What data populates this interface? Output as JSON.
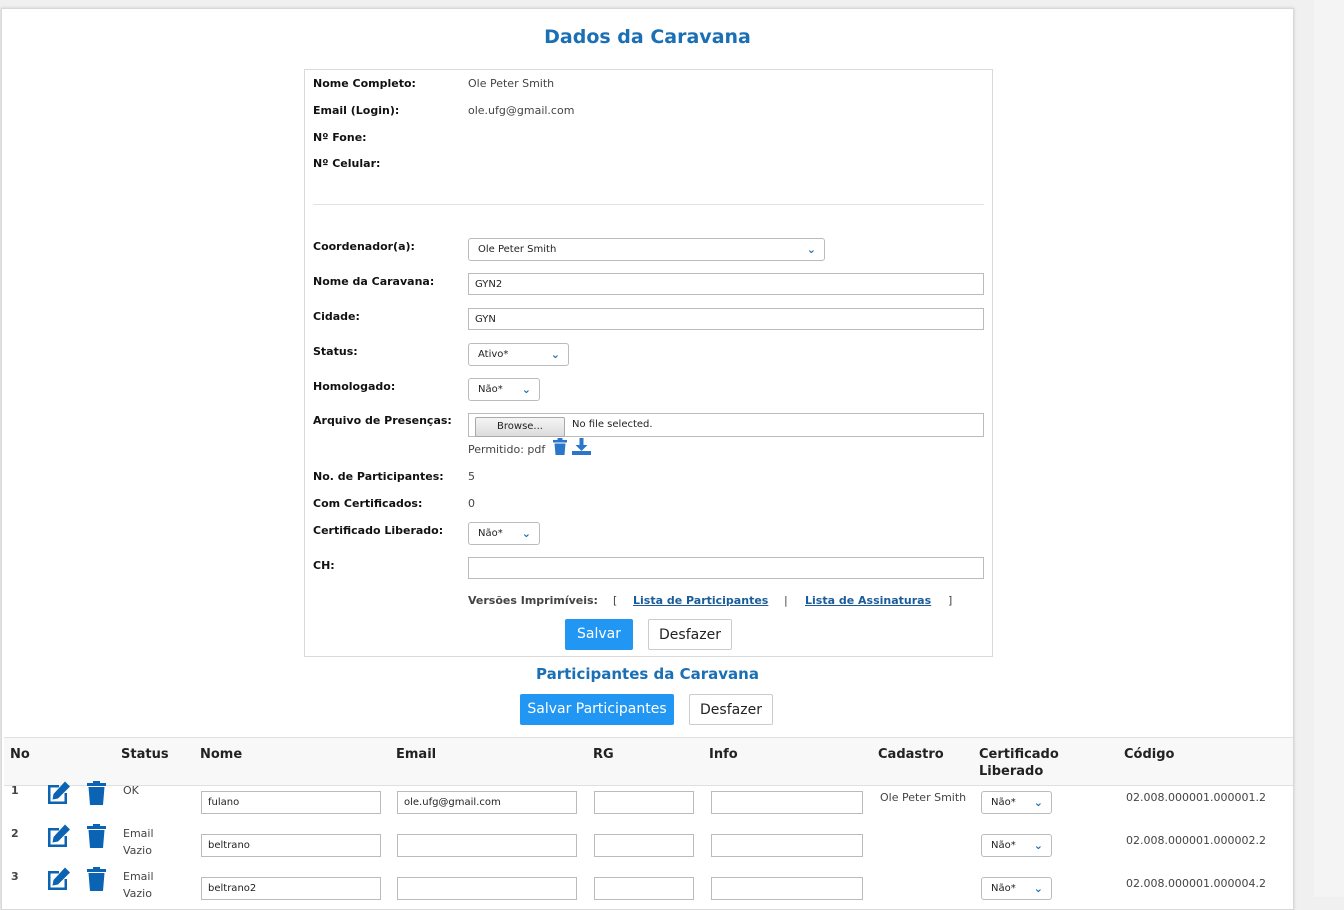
{
  "page": {
    "title": "Dados da Caravana",
    "participants_title": "Participantes da Caravana"
  },
  "profile": {
    "nome_label": "Nome Completo:",
    "nome_value": "Ole Peter Smith",
    "email_label": "Email (Login):",
    "email_value": "ole.ufg@gmail.com",
    "fone_label": "Nº Fone:",
    "fone_value": "",
    "celular_label": "Nº Celular:",
    "celular_value": ""
  },
  "form": {
    "coordenador_label": "Coordenador(a):",
    "coordenador_value": "Ole Peter Smith",
    "nome_caravana_label": "Nome da Caravana:",
    "nome_caravana_value": "GYN2",
    "cidade_label": "Cidade:",
    "cidade_value": "GYN",
    "status_label": "Status:",
    "status_value": "Ativo*",
    "homologado_label": "Homologado:",
    "homologado_value": "Não*",
    "arquivo_label": "Arquivo de Presenças:",
    "browse_label": "Browse...",
    "no_file_text": "No file selected.",
    "permitido_text": "Permitido: pdf",
    "num_part_label": "No. de Participantes:",
    "num_part_value": "5",
    "com_cert_label": "Com Certificados:",
    "com_cert_value": "0",
    "cert_liberado_label": "Certificado Liberado:",
    "cert_liberado_value": "Não*",
    "ch_label": "CH:",
    "ch_value": "",
    "versoes_label": "Versões Imprimíveis:",
    "bracket_open": "[",
    "lista_participantes": "Lista de Participantes",
    "separator": "|",
    "lista_assinaturas": "Lista de Assinaturas",
    "bracket_close": "]",
    "salvar_label": "Salvar",
    "desfazer_label": "Desfazer"
  },
  "participants": {
    "salvar_label": "Salvar Participantes",
    "desfazer_label": "Desfazer",
    "headers": {
      "no": "No",
      "status": "Status",
      "nome": "Nome",
      "email": "Email",
      "rg": "RG",
      "info": "Info",
      "cadastro": "Cadastro",
      "certificado": "Certificado Liberado",
      "codigo": "Código"
    },
    "rows": [
      {
        "no": "1",
        "status": "OK",
        "nome": "fulano",
        "email": "ole.ufg@gmail.com",
        "rg": "",
        "info": "",
        "cadastro": "Ole Peter Smith",
        "certificado": "Não*",
        "codigo": "02.008.000001.000001.2"
      },
      {
        "no": "2",
        "status": "Email Vazio",
        "nome": "beltrano",
        "email": "",
        "rg": "",
        "info": "",
        "cadastro": "",
        "certificado": "Não*",
        "codigo": "02.008.000001.000002.2"
      },
      {
        "no": "3",
        "status": "Email Vazio",
        "nome": "beltrano2",
        "email": "",
        "rg": "",
        "info": "",
        "cadastro": "",
        "certificado": "Não*",
        "codigo": "02.008.000001.000004.2"
      }
    ]
  },
  "colors": {
    "primary": "#2196f3",
    "title": "#1a6fb5",
    "icon": "#0b63b3"
  }
}
